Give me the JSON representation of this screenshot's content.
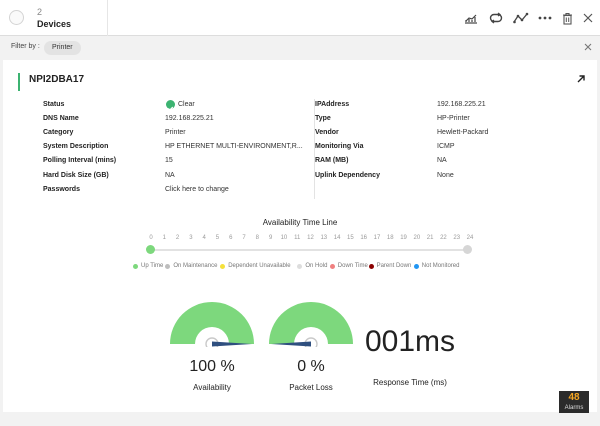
{
  "header": {
    "count": "2",
    "title": "Devices"
  },
  "filter": {
    "label": "Filter by :",
    "chip": "Printer"
  },
  "device": {
    "name": "NPI2DBA17",
    "left_props": [
      {
        "label": "Status",
        "value": "Clear"
      },
      {
        "label": "DNS Name",
        "value": "192.168.225.21"
      },
      {
        "label": "Category",
        "value": "Printer"
      },
      {
        "label": "System Description",
        "value": "HP ETHERNET MULTI-ENVIRONMENT,R..."
      },
      {
        "label": "Polling Interval (mins)",
        "value": "15"
      },
      {
        "label": "Hard Disk Size (GB)",
        "value": "NA"
      },
      {
        "label": "Passwords",
        "value": "Click here to change"
      }
    ],
    "right_props": [
      {
        "label": "IPAddress",
        "value": "192.168.225.21"
      },
      {
        "label": "Type",
        "value": "HP-Printer"
      },
      {
        "label": "Vendor",
        "value": "Hewlett-Packard"
      },
      {
        "label": "Monitoring Via",
        "value": "ICMP"
      },
      {
        "label": "RAM (MB)",
        "value": "NA"
      },
      {
        "label": "Uplink Dependency",
        "value": "None"
      }
    ]
  },
  "timeline": {
    "title": "Availability Time Line",
    "ticks": [
      "0",
      "1",
      "2",
      "3",
      "4",
      "5",
      "6",
      "7",
      "8",
      "9",
      "10",
      "11",
      "12",
      "13",
      "14",
      "15",
      "16",
      "17",
      "18",
      "19",
      "20",
      "21",
      "22",
      "23",
      "24"
    ],
    "legend": [
      {
        "label": "Up Time",
        "color": "#7dd87d"
      },
      {
        "label": "On Maintenance",
        "color": "#bdbdbd"
      },
      {
        "label": "Dependent Unavailable",
        "color": "#f5e13b"
      },
      {
        "label": "On Hold",
        "color": "#dddddd"
      },
      {
        "label": "Down Time",
        "color": "#f08080"
      },
      {
        "label": "Parent Down",
        "color": "#8b0000"
      },
      {
        "label": "Not Monitored",
        "color": "#2196f3"
      }
    ]
  },
  "metrics": {
    "availability": {
      "value": "100 %",
      "label": "Availability",
      "fraction": 1.0
    },
    "packet_loss": {
      "value": "0 %",
      "label": "Packet Loss",
      "fraction": 0.0
    },
    "response_time": {
      "value": "001ms",
      "label": "Response Time (ms)"
    }
  },
  "alarms": {
    "count": "48",
    "label": "Alarms"
  },
  "colors": {
    "accent": "#3cb371",
    "gauge_fill": "#7dd87d",
    "needle": "#2f4f7f"
  }
}
